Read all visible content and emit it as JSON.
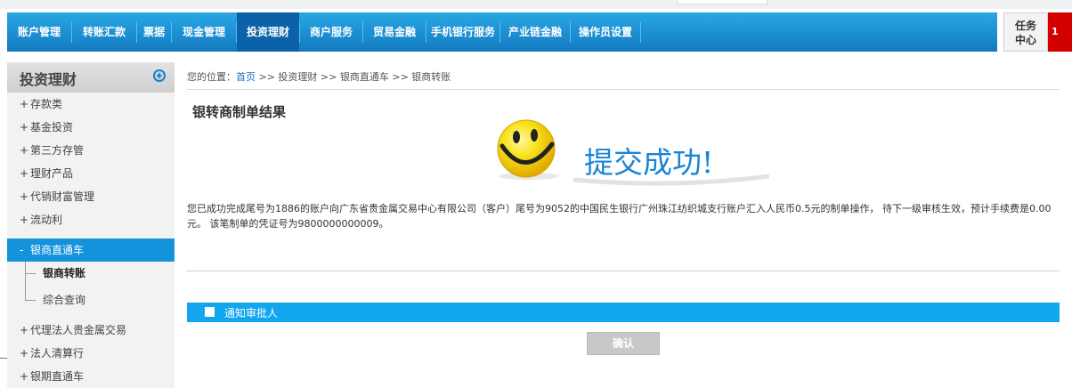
{
  "nav": {
    "items": [
      {
        "label": "账户管理"
      },
      {
        "label": "转账汇款"
      },
      {
        "label": "票据"
      },
      {
        "label": "现金管理"
      },
      {
        "label": "投资理财"
      },
      {
        "label": "商户服务"
      },
      {
        "label": "贸易金融"
      },
      {
        "label": "手机银行服务"
      },
      {
        "label": "产业链金融"
      },
      {
        "label": "操作员设置"
      }
    ],
    "active_index": 4
  },
  "task_center": {
    "line1": "任务",
    "line2": "中心",
    "badge": "1"
  },
  "sidebar": {
    "title": "投资理财",
    "collapse_icon": "circle-arrow-left-icon",
    "items": [
      {
        "mark": "+",
        "label": "存款类"
      },
      {
        "mark": "+",
        "label": "基金投资"
      },
      {
        "mark": "+",
        "label": "第三方存管"
      },
      {
        "mark": "+",
        "label": "理财产品"
      },
      {
        "mark": "+",
        "label": "代销财富管理"
      },
      {
        "mark": "+",
        "label": "流动利"
      },
      {
        "mark": "-",
        "label": "银商直通车"
      },
      {
        "mark": "",
        "label": "银商转账"
      },
      {
        "mark": "",
        "label": "综合查询"
      },
      {
        "mark": "+",
        "label": "代理法人贵金属交易"
      },
      {
        "mark": "+",
        "label": "法人清算行"
      },
      {
        "mark": "+",
        "label": "银期直通车"
      }
    ]
  },
  "breadcrumb": {
    "prefix": "您的位置：",
    "home": "首页",
    "rest": " >> 投资理财 >> 银商直通车 >> 银商转账"
  },
  "page": {
    "title": "银转商制单结果",
    "success_text": "提交成功!",
    "success_icon": "smiley-icon",
    "message": "您已成功完成尾号为1886的账户向广东省贵金属交易中心有限公司（客户）尾号为9052的中国民生银行广州珠江纺织城支行账户汇入人民币0.5元的制单操作， 待下一级审核生效，预计手续费是0.00元。 该笔制单的凭证号为9800000000009。",
    "notify_label": "通知审批人",
    "confirm_label": "确认"
  },
  "colors": {
    "nav": "#1b8fd3",
    "nav_active": "#0b62a8",
    "accent": "#12a6ef",
    "sidebar_active": "#1592dc",
    "badge": "#d30000",
    "success_text": "#1a84d6"
  }
}
